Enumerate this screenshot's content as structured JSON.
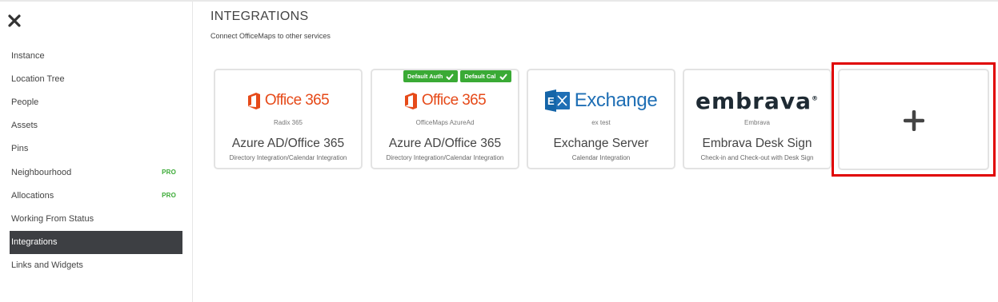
{
  "sidebar": {
    "items": [
      {
        "label": "Instance",
        "badge": ""
      },
      {
        "label": "Location Tree",
        "badge": ""
      },
      {
        "label": "People",
        "badge": ""
      },
      {
        "label": "Assets",
        "badge": ""
      },
      {
        "label": "Pins",
        "badge": ""
      },
      {
        "label": "Neighbourhood",
        "badge": "PRO"
      },
      {
        "label": "Allocations",
        "badge": "PRO"
      },
      {
        "label": "Working From Status",
        "badge": ""
      },
      {
        "label": "Integrations",
        "badge": "",
        "active": true
      },
      {
        "label": "Links and Widgets",
        "badge": ""
      }
    ]
  },
  "header": {
    "title": "INTEGRATIONS",
    "subtitle": "Connect OfficeMaps to other services"
  },
  "integrations": [
    {
      "logo": "office365-logo",
      "logo_text": "Office 365",
      "subname": "Radix 365",
      "name": "Azure AD/Office 365",
      "description": "Directory Integration/Calendar Integration",
      "badges": []
    },
    {
      "logo": "office365-logo",
      "logo_text": "Office 365",
      "subname": "OfficeMaps AzureAd",
      "name": "Azure AD/Office 365",
      "description": "Directory Integration/Calendar Integration",
      "badges": [
        "Default Auth",
        "Default Cal"
      ]
    },
    {
      "logo": "exchange-logo",
      "logo_text": "Exchange",
      "subname": "ex test",
      "name": "Exchange Server",
      "description": "Calendar Integration",
      "badges": []
    },
    {
      "logo": "embrava-logo",
      "logo_text": "embrava",
      "subname": "Embrava",
      "name": "Embrava Desk Sign",
      "description": "Check-in and Check-out with Desk Sign",
      "badges": []
    }
  ],
  "colors": {
    "active_nav_bg": "#3d3f43",
    "pro_badge": "#3aaa35",
    "default_badge": "#3aaa35",
    "office_orange": "#e64a19",
    "exchange_blue": "#1f6fb5",
    "highlight_frame": "#e00000"
  },
  "icons": {
    "close": "close-icon",
    "add": "plus-icon",
    "badge_check": "checkmark-icon"
  }
}
